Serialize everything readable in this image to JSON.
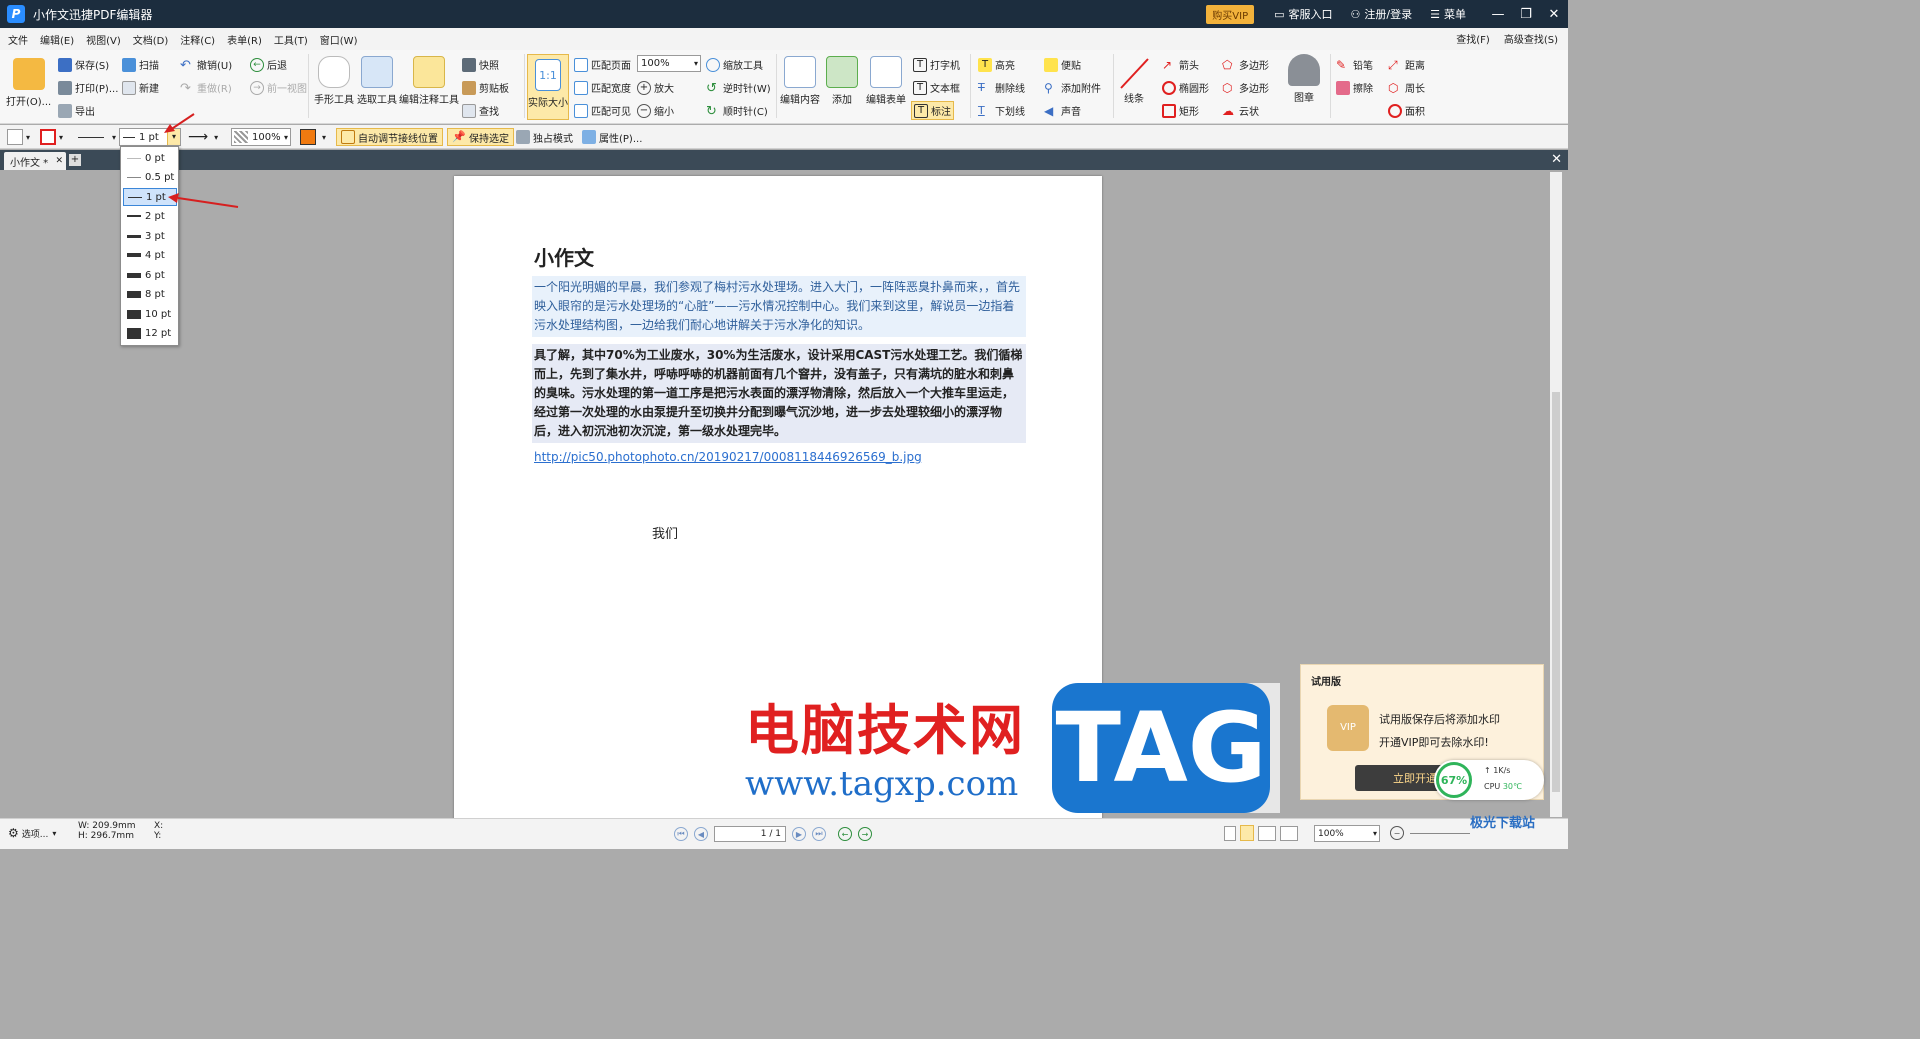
{
  "window": {
    "title": "小作文迅捷PDF编辑器",
    "vip_label": "购买VIP",
    "service_label": "客服入口",
    "login_label": "注册/登录",
    "menu_label": "菜单"
  },
  "menubar": {
    "items": [
      "文件",
      "编辑(E)",
      "视图(V)",
      "文档(D)",
      "注释(C)",
      "表单(R)",
      "工具(T)",
      "窗口(W)"
    ],
    "find_label": "查找(F)",
    "adv_find_label": "高级查找(S)"
  },
  "ribbon": {
    "open": "打开(O)...",
    "save": "保存(S)",
    "print": "打印(P)...",
    "export": "导出",
    "scan": "扫描",
    "new": "新建",
    "undo": "撤销(U)",
    "redo": "重做(R)",
    "back": "后退",
    "prev_view": "前一视图",
    "hand_tool": "手形工具",
    "select_tool": "选取工具",
    "edit_annot_tool": "编辑注释工具",
    "snapshot": "快照",
    "clipboard": "剪贴板",
    "find": "查找",
    "actual_size": "实际大小",
    "fit_page": "匹配页面",
    "fit_width": "匹配宽度",
    "fit_visible": "匹配可见",
    "zoom_value": "100%",
    "zoom_in": "放大",
    "zoom_out": "缩小",
    "zoom_tool": "缩放工具",
    "rotate_ccw": "逆时针(W)",
    "rotate_cw": "顺时针(C)",
    "edit_content": "编辑内容",
    "add": "添加",
    "edit_form": "编辑表单",
    "typewriter": "打字机",
    "textbox": "文本框",
    "callout": "标注",
    "highlight": "高亮",
    "strikeout": "删除线",
    "underline": "下划线",
    "note": "便贴",
    "attach": "添加附件",
    "sound": "声音",
    "line": "线条",
    "arrow": "箭头",
    "ellipse": "椭圆形",
    "rect": "矩形",
    "polygon1": "多边形",
    "polygon2": "多边形",
    "cloud": "云状",
    "stamp": "图章",
    "pencil": "铅笔",
    "eraser": "擦除",
    "distance": "距离",
    "perimeter": "周长",
    "area": "面积"
  },
  "toolbar2": {
    "line_width": "1 pt",
    "opacity": "100%",
    "auto_adjust": "自动调节接线位置",
    "keep_selected": "保持选定",
    "exclusive_mode": "独占模式",
    "properties": "属性(P)..."
  },
  "dropdown": {
    "options": [
      "0 pt",
      "0.5 pt",
      "1 pt",
      "2 pt",
      "3 pt",
      "4 pt",
      "6 pt",
      "8 pt",
      "10 pt",
      "12 pt"
    ],
    "selected": "1 pt"
  },
  "tab": {
    "label": "小作文 *"
  },
  "document": {
    "title": "小作文",
    "para1": "一个阳光明媚的早晨，我们参观了梅村污水处理场。进入大门，一阵阵恶臭扑鼻而来，，首先映入眼帘的是污水处理场的“心脏”——污水情况控制中心。我们来到这里，解说员一边指着污水处理结构图，一边给我们耐心地讲解关于污水净化的知识。",
    "para2": "具了解，其中70%为工业废水，30%为生活废水，设计采用CAST污水处理工艺。我们循梯而上，先到了集水井，呼哧呼哧的机器前面有几个窨井，没有盖子，只有满坑的脏水和刺鼻的臭味。污水处理的第一道工序是把污水表面的漂浮物清除，然后放入一个大推车里运走，经过第一次处理的水由泵提升至切换井分配到曝气沉沙地，进一步去处理较细小的漂浮物后，进入初沉池初次沉淀，第一级水处理完毕。",
    "link": "http://pic50.photophoto.cn/20190217/0008118446926569_b.jpg",
    "text3": "我们"
  },
  "trial": {
    "title": "试用版",
    "line1": "试用版保存后将添加水印",
    "line2": "开通VIP即可去除水印!",
    "button": "立即开通",
    "badge": "VIP"
  },
  "cpu_widget": {
    "percent": "67%",
    "speed": "1K/s",
    "cpu": "CPU",
    "temp": "30℃"
  },
  "watermark": {
    "cn": "电脑技术网",
    "url": "www.tagxp.com",
    "tag": "TAG",
    "site": "极光下载站"
  },
  "statusbar": {
    "options": "选项...",
    "width": "W: 209.9mm",
    "height": "H: 296.7mm",
    "x": "X:",
    "y": "Y:",
    "page": "1 / 1",
    "zoom": "100%"
  },
  "colors": {
    "titlebar": "#1c2d3e",
    "accent_red": "#e02020",
    "selection": "#cfe3fb"
  }
}
